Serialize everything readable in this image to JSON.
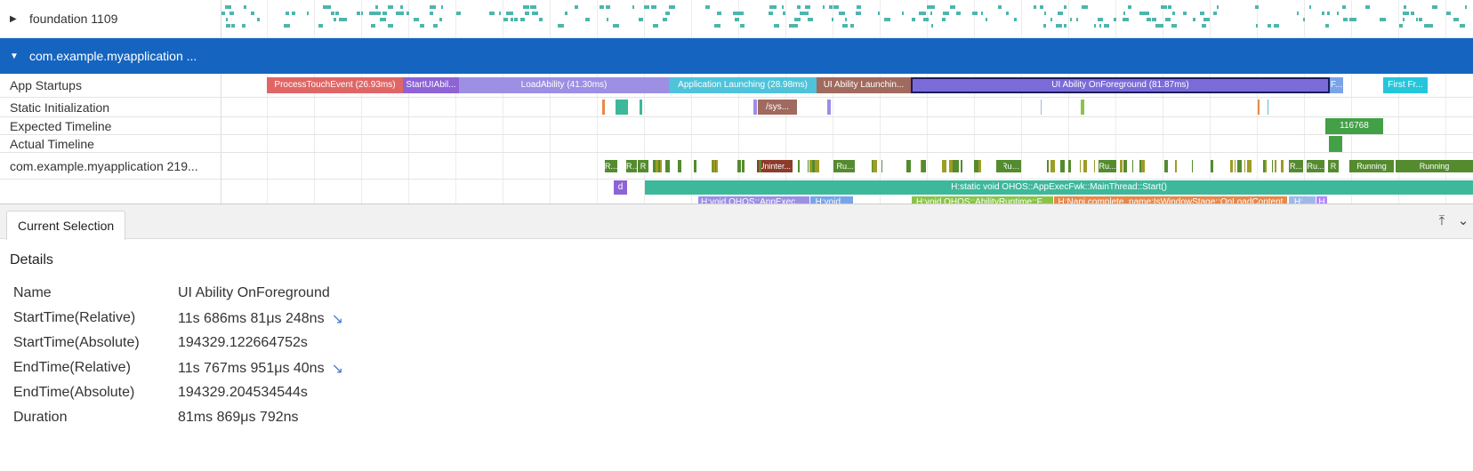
{
  "rows": {
    "foundation_label": "foundation 1109",
    "process_label": "com.example.myapplication ...",
    "app_startups_label": "App Startups",
    "static_init_label": "Static Initialization",
    "expected_timeline_label": "Expected Timeline",
    "actual_timeline_label": "Actual Timeline",
    "thread_label": "com.example.myapplication 219..."
  },
  "startups": [
    {
      "name": "ProcessTouchEvent (26.93ms)",
      "color": "#e06666"
    },
    {
      "name": "StartUIAbil...",
      "color": "#8e63d6"
    },
    {
      "name": "LoadAbility (41.30ms)",
      "color": "#9c8fe4"
    },
    {
      "name": "Application Launching (28.98ms)",
      "color": "#4fc3d9"
    },
    {
      "name": "UI Ability Launchin...",
      "color": "#a06a5e"
    },
    {
      "name": "UI Ability OnForeground (81.87ms)",
      "color": "#7a6bd8"
    },
    {
      "name": "F...",
      "color": "#7aa3e8"
    },
    {
      "name": "First Fr...",
      "color": "#26c6da"
    }
  ],
  "static_init": {
    "slice_label": "/sys..."
  },
  "expected": {
    "frame_label": "116768"
  },
  "thread_states": [
    "R...",
    "R...",
    "R",
    "Uninter...",
    "Ru...",
    "Run...",
    "Ru...",
    "R...",
    "Ru...",
    "R",
    "Running",
    "Running"
  ],
  "slices": {
    "main_start": "H:static void OHOS::AppExecFwk::MainThread::Start()",
    "d_label": "d",
    "sub1": "H:void OHOS::AppExecFwk...",
    "sub2": "H:void...",
    "sub3": "H:void OHOS::AbilityRuntime::F...",
    "sub4": "H:Napi complete, name:IsWindowStage::OnLoadContent",
    "sub5": "H:...",
    "sub6": "H"
  },
  "panel": {
    "tab": "Current Selection",
    "details_title": "Details",
    "fields": [
      {
        "key": "Name",
        "value": "UI Ability OnForeground"
      },
      {
        "key": "StartTime(Relative)",
        "value": "11s 686ms 81μs 248ns"
      },
      {
        "key": "StartTime(Absolute)",
        "value": "194329.122664752s"
      },
      {
        "key": "EndTime(Relative)",
        "value": "11s 767ms 951μs 40ns"
      },
      {
        "key": "EndTime(Absolute)",
        "value": "194329.204534544s"
      },
      {
        "key": "Duration",
        "value": "81ms 869μs 792ns"
      }
    ]
  }
}
